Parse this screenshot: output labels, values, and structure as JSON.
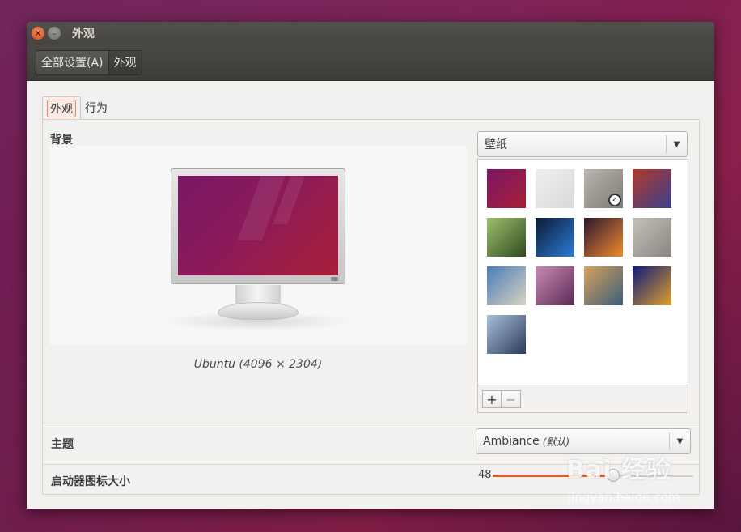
{
  "window": {
    "title": "外观"
  },
  "toolbar": {
    "crumbs": [
      "全部设置(A)",
      "外观"
    ]
  },
  "tabs": [
    "外观",
    "行为"
  ],
  "background": {
    "section_label": "背景",
    "caption": "Ubuntu (4096 × 2304)",
    "source_combo": "壁纸",
    "wallpapers": [
      {
        "name": "wallpaper-purple",
        "selected": false,
        "colors": [
          "#7a1766",
          "#a81f38"
        ]
      },
      {
        "name": "wallpaper-light-grey",
        "selected": false,
        "colors": [
          "#efefef",
          "#d9d9d9"
        ]
      },
      {
        "name": "wallpaper-pebbles",
        "selected": true,
        "colors": [
          "#b9b4ad",
          "#7f7a73"
        ]
      },
      {
        "name": "wallpaper-abstract-red",
        "selected": false,
        "colors": [
          "#b33a2a",
          "#3a3f8f"
        ]
      },
      {
        "name": "wallpaper-mantis",
        "selected": false,
        "colors": [
          "#9ec06b",
          "#2f4a22"
        ]
      },
      {
        "name": "wallpaper-blue-lights",
        "selected": false,
        "colors": [
          "#0a1a33",
          "#2f7bd8"
        ]
      },
      {
        "name": "wallpaper-concert",
        "selected": false,
        "colors": [
          "#2a1630",
          "#f08a2c"
        ]
      },
      {
        "name": "wallpaper-pebbles-2",
        "selected": false,
        "colors": [
          "#c4c0ba",
          "#8a857f"
        ]
      },
      {
        "name": "wallpaper-beach-posts",
        "selected": false,
        "colors": [
          "#4a7db8",
          "#d9d2c2"
        ]
      },
      {
        "name": "wallpaper-purple-flowers",
        "selected": false,
        "colors": [
          "#c98ab5",
          "#5a2a55"
        ]
      },
      {
        "name": "wallpaper-sea-rocks",
        "selected": false,
        "colors": [
          "#d8a15c",
          "#3a5f7a"
        ]
      },
      {
        "name": "wallpaper-blue-orange",
        "selected": false,
        "colors": [
          "#0c1a7a",
          "#e0a02a"
        ]
      },
      {
        "name": "wallpaper-sunset-grass",
        "selected": false,
        "colors": [
          "#a9c0d8",
          "#2a3a5a"
        ]
      }
    ],
    "add_label": "+",
    "remove_label": "−"
  },
  "theme": {
    "section_label": "主题",
    "value": "Ambiance",
    "note": "(默认)"
  },
  "launcher": {
    "section_label": "启动器图标大小",
    "value_label": "48",
    "level_fraction": 0.6
  },
  "watermark": {
    "main": "Bai 经验",
    "sub": "jingyan.baidu.com"
  }
}
